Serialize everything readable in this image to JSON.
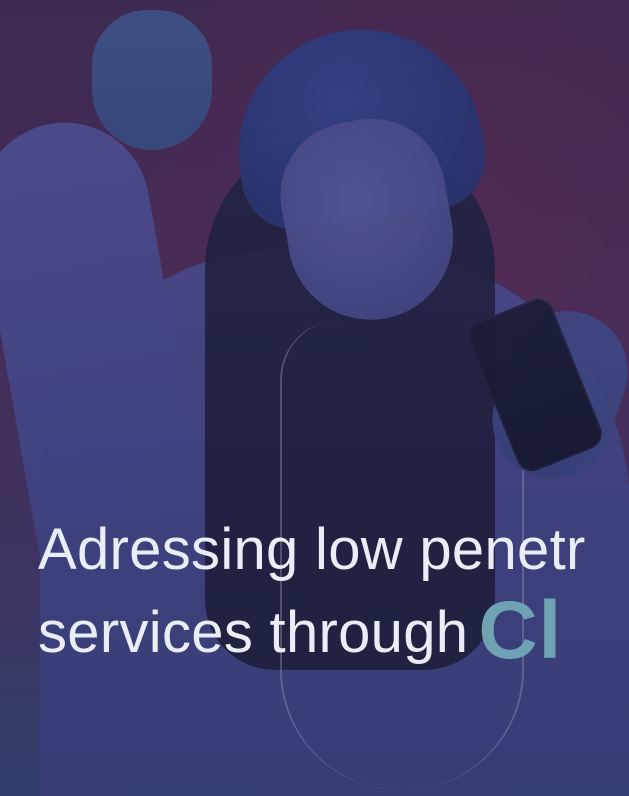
{
  "hero": {
    "headline_line_1": "Adressing low penetr",
    "headline_line_2_prefix": "services through",
    "headline_brand_fragment": "Cl"
  },
  "colors": {
    "headline_text": "#e9eef6",
    "brand_text": "#6fa3b3"
  }
}
